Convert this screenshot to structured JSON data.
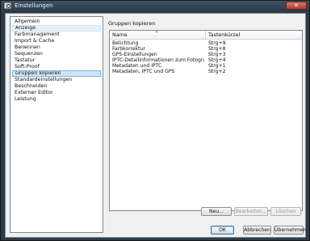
{
  "window": {
    "title": "Einstellungen",
    "close_glyph": "✕"
  },
  "sidebar": {
    "items": [
      {
        "label": "Allgemein",
        "state": "normal"
      },
      {
        "label": "Anzeige",
        "state": "hover"
      },
      {
        "label": "Farbmanagement",
        "state": "normal"
      },
      {
        "label": "Import & Cache",
        "state": "normal"
      },
      {
        "label": "Benennen",
        "state": "normal"
      },
      {
        "label": "Sequenzen",
        "state": "normal"
      },
      {
        "label": "Tastatur",
        "state": "normal"
      },
      {
        "label": "Soft-Proof",
        "state": "normal"
      },
      {
        "label": "Gruppen kopieren",
        "state": "selected"
      },
      {
        "label": "Standardeinstellungen",
        "state": "normal"
      },
      {
        "label": "Beschneiden",
        "state": "normal"
      },
      {
        "label": "Externer Editor",
        "state": "normal"
      },
      {
        "label": "Leistung",
        "state": "normal"
      }
    ]
  },
  "main": {
    "section_title": "Gruppen kopieren",
    "columns": {
      "name": "Name",
      "shortcut": "Tastenkürzel"
    },
    "rows": [
      {
        "name": "Belichtung",
        "shortcut": "Strg+9"
      },
      {
        "name": "Farbkorrektur",
        "shortcut": "Strg+8"
      },
      {
        "name": "GPS-Einstellungen",
        "shortcut": "Strg+3"
      },
      {
        "name": "IPTC-Detailinformationen zum Fotografen",
        "shortcut": "Strg+4"
      },
      {
        "name": "Metadaten und IPTC",
        "shortcut": "Strg+1"
      },
      {
        "name": "Metadaten, IPTC und GPS",
        "shortcut": "Strg+2"
      }
    ],
    "buttons": {
      "new": "Neu...",
      "edit": "Bearbeiten...",
      "delete": "Löschen"
    }
  },
  "footer": {
    "ok": "OK",
    "cancel": "Abbrechen",
    "apply": "Übernehmen"
  },
  "colors": {
    "selection": "#cde6f7",
    "selection_border": "#7db3de",
    "titlebar": "#2a3a49"
  }
}
